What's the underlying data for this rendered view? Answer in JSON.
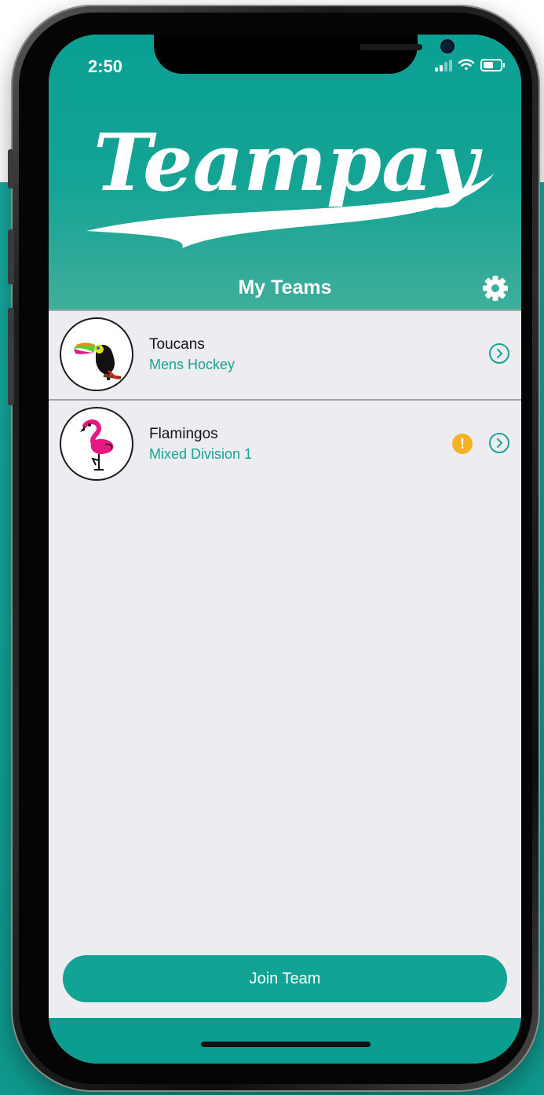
{
  "status_bar": {
    "time": "2:50"
  },
  "header": {
    "logo_text": "Teampay",
    "title": "My Teams"
  },
  "teams": [
    {
      "name": "Toucans",
      "division": "Mens Hockey",
      "alert": false
    },
    {
      "name": "Flamingos",
      "division": "Mixed Division 1",
      "alert": true,
      "alert_symbol": "!"
    }
  ],
  "footer": {
    "join_label": "Join Team"
  },
  "colors": {
    "accent": "#11a393",
    "warning": "#f6b226",
    "list_bg": "#ececf1"
  }
}
